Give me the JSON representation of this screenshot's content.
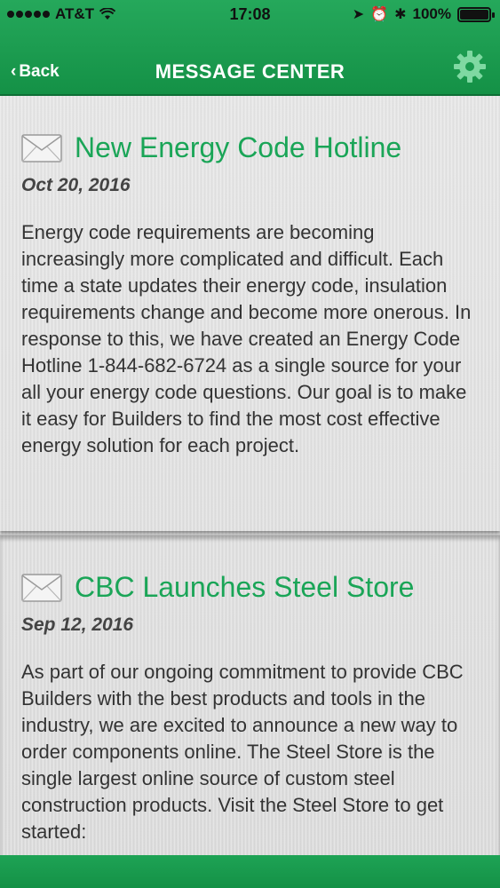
{
  "status_bar": {
    "carrier": "AT&T",
    "time": "17:08",
    "battery": "100%"
  },
  "nav": {
    "back_label": "Back",
    "title": "MESSAGE CENTER"
  },
  "icons": {
    "settings": "gear-icon",
    "message": "envelope-icon"
  },
  "colors": {
    "brand_green": "#149146",
    "title_green": "#1aa557"
  },
  "messages": [
    {
      "title": "New Energy Code Hotline",
      "date": "Oct 20, 2016",
      "body": "Energy code requirements are becoming increasingly more complicated and difficult. Each time a state updates their energy code, insulation requirements change and become more onerous. In response to this, we have created an Energy Code Hotline 1-844-682-6724 as a single source for your all your energy code questions. Our goal is to make it easy for Builders to find the most cost effective energy solution for each project."
    },
    {
      "title": "CBC Launches Steel Store",
      "date": "Sep 12, 2016",
      "body": "As part of our ongoing commitment to provide CBC Builders with the best products and tools in the industry, we are excited to announce a new way to order components online. The Steel Store is the single largest online source of custom steel construction products. Visit the Steel Store to get started:"
    }
  ]
}
